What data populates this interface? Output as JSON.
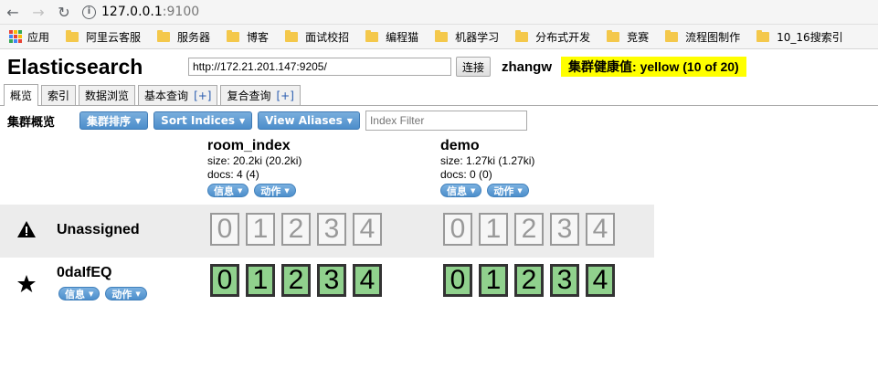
{
  "browser": {
    "url_host": "127.0.0.1",
    "url_port": ":9100",
    "apps_label": "应用",
    "bookmarks": [
      "阿里云客服",
      "服务器",
      "博客",
      "面试校招",
      "编程猫",
      "机器学习",
      "分布式开发",
      "竞赛",
      "流程图制作",
      "10_16搜索引"
    ]
  },
  "header": {
    "title": "Elasticsearch",
    "connection_url": "http://172.21.201.147:9205/",
    "connect_label": "连接",
    "cluster_name": "zhangw",
    "health_text": "集群健康值: yellow (10 of 20)"
  },
  "tabs": [
    {
      "label": "概览"
    },
    {
      "label": "索引"
    },
    {
      "label": "数据浏览"
    },
    {
      "label": "基本查询",
      "plus": "[+]"
    },
    {
      "label": "复合查询",
      "plus": "[+]"
    }
  ],
  "toolbar": {
    "label": "集群概览",
    "sort_cluster": "集群排序",
    "sort_indices": "Sort Indices",
    "view_aliases": "View Aliases",
    "filter_placeholder": "Index Filter"
  },
  "indices": [
    {
      "name": "room_index",
      "size": "size: 20.2ki (20.2ki)",
      "docs": "docs: 4 (4)",
      "info": "信息",
      "action": "动作"
    },
    {
      "name": "demo",
      "size": "size: 1.27ki (1.27ki)",
      "docs": "docs: 0 (0)",
      "info": "信息",
      "action": "动作"
    }
  ],
  "nodes": [
    {
      "name": "Unassigned",
      "icon": "warning-icon"
    },
    {
      "name": "0daIfEQ",
      "icon": "star-icon",
      "info": "信息",
      "action": "动作"
    }
  ],
  "shards": {
    "unassigned": [
      "0",
      "1",
      "2",
      "3",
      "4"
    ],
    "assigned": [
      "0",
      "1",
      "2",
      "3",
      "4"
    ]
  },
  "colors": {
    "health": "#ffff00",
    "assigned_shard": "#90d18d",
    "button_blue": "#4c8dcb"
  }
}
